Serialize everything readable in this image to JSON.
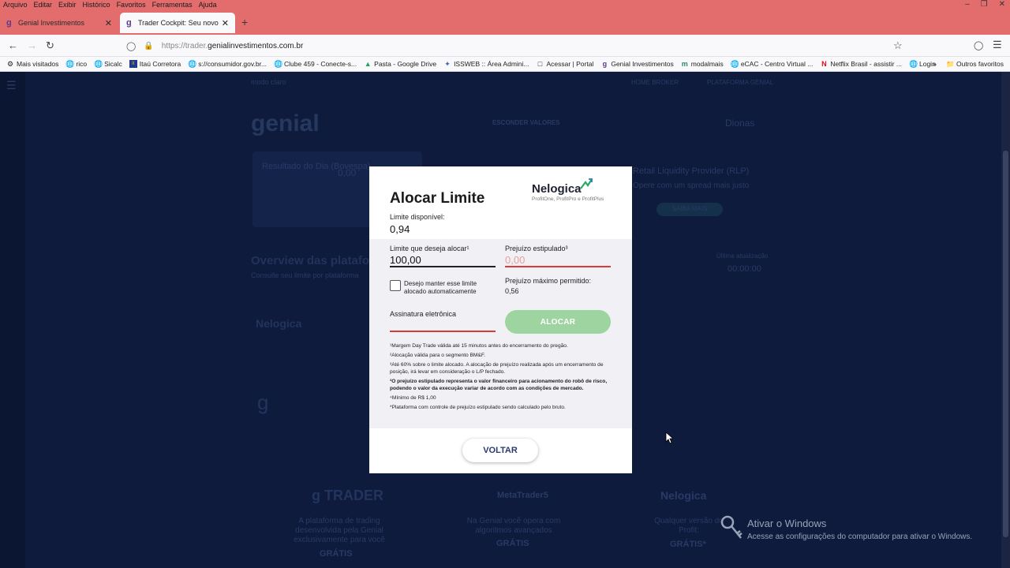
{
  "menu": [
    "Arquivo",
    "Editar",
    "Exibir",
    "Histórico",
    "Favoritos",
    "Ferramentas",
    "Ajuda"
  ],
  "tabs": [
    {
      "title": "Genial Investimentos",
      "favicon": "g"
    },
    {
      "title": "Trader Cockpit: Seu novo portal",
      "favicon": "g"
    }
  ],
  "address": {
    "prefix": "https://trader.",
    "domain": "genialinvestimentos.com.br"
  },
  "bookmarks": [
    {
      "label": "Mais visitados",
      "icon": "gear-icon"
    },
    {
      "label": "rico",
      "icon": "globe-icon"
    },
    {
      "label": "Sicalc",
      "icon": "globe-icon"
    },
    {
      "label": "Itaú Corretora",
      "icon": "itau-icon"
    },
    {
      "label": "s://consumidor.gov.br...",
      "icon": "globe-icon"
    },
    {
      "label": "Clube 459 - Conecte-s...",
      "icon": "globe-icon"
    },
    {
      "label": "Pasta - Google Drive",
      "icon": "drive-icon"
    },
    {
      "label": "ISSWEB :: Área Admini...",
      "icon": "star-icon"
    },
    {
      "label": "Acessar | Portal",
      "icon": "page-icon"
    },
    {
      "label": "Genial Investimentos",
      "icon": "g-icon"
    },
    {
      "label": "modalmais",
      "icon": "m-icon"
    },
    {
      "label": "eCAC - Centro Virtual ...",
      "icon": "globe-icon"
    },
    {
      "label": "Netflix Brasil - assistir ...",
      "icon": "netflix-icon"
    },
    {
      "label": "Login",
      "icon": "globe-icon"
    }
  ],
  "bookmarks_more": "»",
  "bookmarks_other": "Outros favoritos",
  "background": {
    "mode_label": "modo claro",
    "home_broker": "HOME BROKER",
    "plataforma": "PLATAFORMA GENIAL",
    "esconder": "ESCONDER VALORES",
    "user": "Dionas",
    "resultado": "Resultado do Dia (Bovespa)",
    "resultado_val": "0,00",
    "overview": "Overview das plataformas",
    "overview_sub": "Consulte seu limite por plataforma",
    "rlp_title": "Retail Liquidity Provider (RLP)",
    "rlp_sub": "Opere com um spread mais justo",
    "rlp_btn": "SAIBA MAIS",
    "ultima": "Última atualização",
    "ultima_val": "00:00:00",
    "trader_promo": "A plataforma de trading desenvolvida pela Genial exclusivamente para você",
    "trader_gratis": "GRÁTIS",
    "mt5": "MetaTrader5",
    "mt5_promo": "Na Genial você opera com algoritmos avançados",
    "mt5_gratis": "GRÁTIS",
    "nel_promo": "Qualquer versão do Profit:",
    "nel_gratis": "GRÁTIS*"
  },
  "modal": {
    "title": "Alocar Limite",
    "logo_name": "Nelogica",
    "logo_sub": "ProfitOne, ProfitPro e ProfitPlus",
    "limite_disponivel_label": "Limite disponível:",
    "limite_disponivel_value": "0,94",
    "limite_alocar_label": "Limite que deseja alocar¹",
    "limite_alocar_value": "100,00",
    "prejuizo_label": "Prejuízo estipulado³",
    "prejuizo_value": "0,00",
    "checkbox_label": "Desejo manter esse limite alocado automaticamente",
    "prejuizo_max_label": "Prejuízo máximo permitido:",
    "prejuizo_max_value": "0,56",
    "assinatura_label": "Assinatura eletrônica",
    "alocar_button": "ALOCAR",
    "voltar_button": "VOLTAR",
    "notes": [
      {
        "text": "¹Margem Day Trade válida até 15 minutos antes do encerramento do pregão.",
        "bold": false
      },
      {
        "text": "²Alocação válida para o segmento BM&F.",
        "bold": false
      },
      {
        "text": "³Até 60% sobre o limite alocado. A alocação de prejuízo realizada após um encerramento de posição, irá levar em consideração o L/P fechado.",
        "bold": false
      },
      {
        "text": "³O prejuízo estipulado representa o valor financeiro para acionamento do robô de risco, podendo o valor da execução variar de acordo com as condições de mercado.",
        "bold": true
      },
      {
        "text": "⁴Mínimo de R$ 1,00",
        "bold": false
      },
      {
        "text": "*Plataforma com controle de prejuízo estipulado sendo calculado pelo bruto.",
        "bold": false
      }
    ],
    "colors": {
      "alocar_disabled": "#9ed4a0",
      "error_red": "#d93a3a",
      "voltar_text": "#2b3a6e"
    }
  },
  "watermark": {
    "title": "Ativar o Windows",
    "subtitle": "Acesse as configurações do computador para ativar o Windows."
  }
}
